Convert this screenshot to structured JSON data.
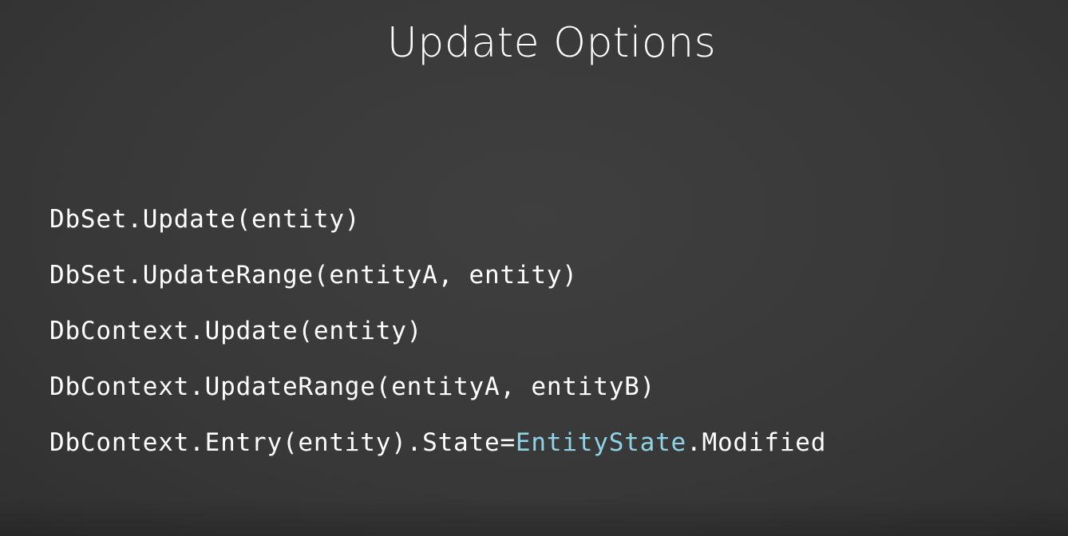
{
  "slide": {
    "title": "Update Options",
    "lines": [
      {
        "text": "DbSet.Update(entity)"
      },
      {
        "text": "DbSet.UpdateRange(entityA, entity)"
      },
      {
        "text": "DbContext.Update(entity)"
      },
      {
        "text": "DbContext.UpdateRange(entityA, entityB)"
      },
      {
        "prefix": "DbContext.Entry(entity).State=",
        "highlight": "EntityState",
        "suffix": ".Modified"
      }
    ]
  },
  "colors": {
    "background": "#3a3a3a",
    "text": "#ffffff",
    "accent": "#8fd4e6"
  }
}
